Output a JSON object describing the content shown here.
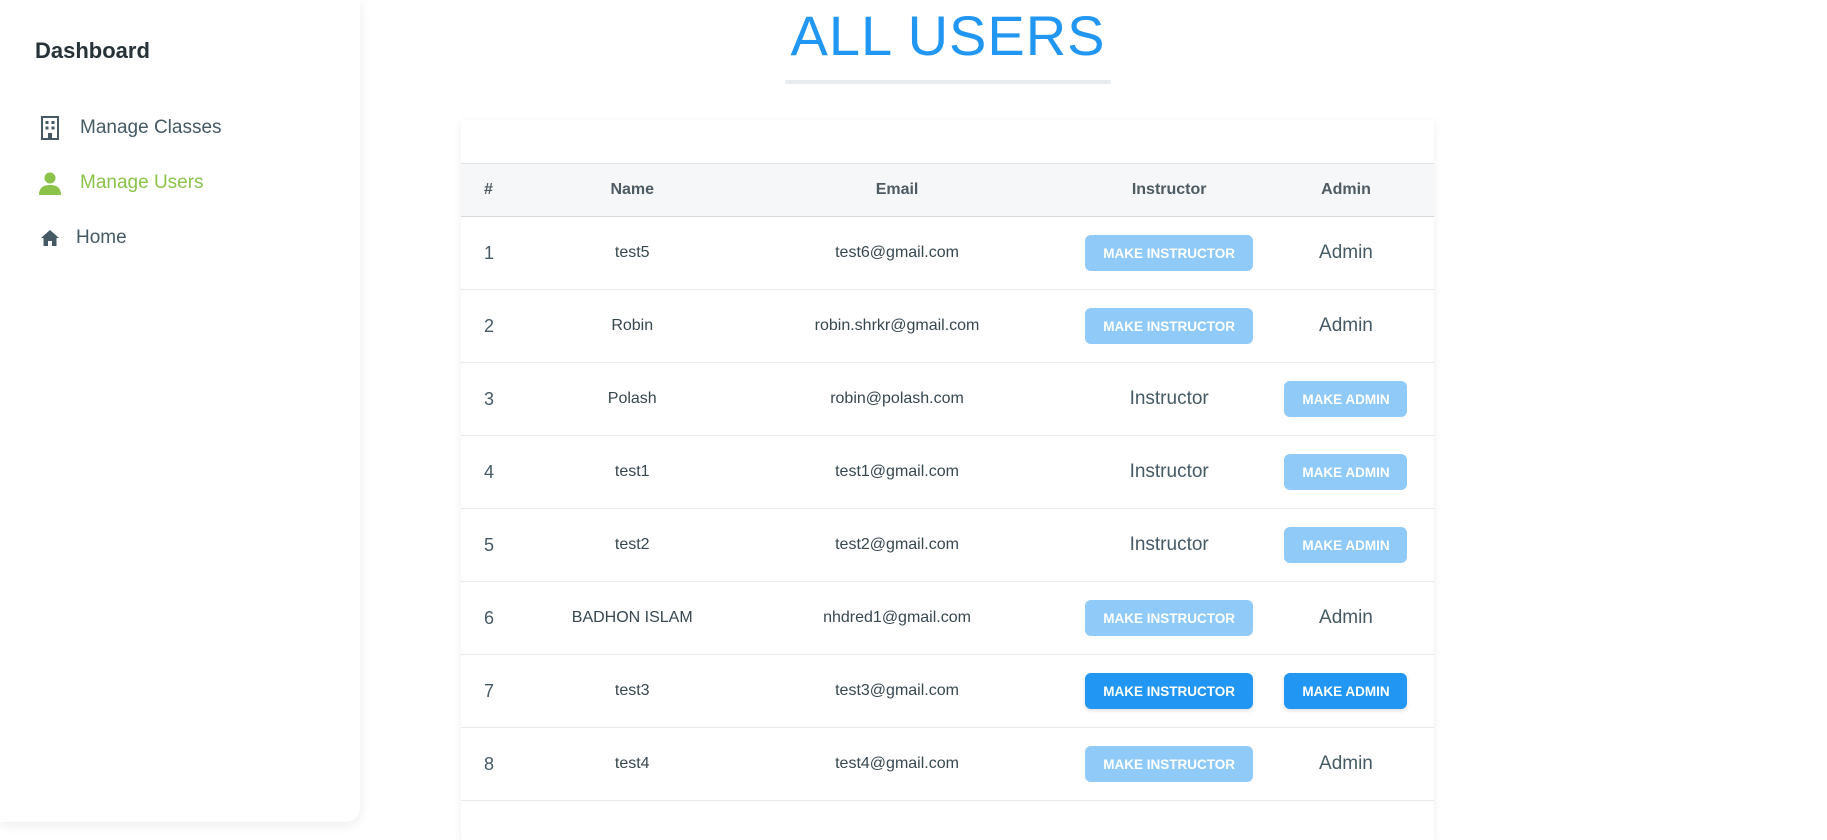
{
  "sidebar": {
    "title": "Dashboard",
    "items": [
      {
        "label": "Manage Classes",
        "icon": "building-icon"
      },
      {
        "label": "Manage Users",
        "icon": "user-icon",
        "active": true
      },
      {
        "label": "Home",
        "icon": "home-icon"
      }
    ]
  },
  "page": {
    "title": "ALL USERS"
  },
  "table": {
    "headers": [
      "#",
      "Name",
      "Email",
      "Instructor",
      "Admin"
    ],
    "rows": [
      {
        "num": "1",
        "name": "test5",
        "email": "test6@gmail.com",
        "instructor": "MAKE INSTRUCTOR",
        "admin": "Admin"
      },
      {
        "num": "2",
        "name": "Robin",
        "email": "robin.shrkr@gmail.com",
        "instructor": "MAKE INSTRUCTOR",
        "admin": "Admin"
      },
      {
        "num": "3",
        "name": "Polash",
        "email": "robin@polash.com",
        "instructor": "Instructor",
        "admin": "MAKE ADMIN"
      },
      {
        "num": "4",
        "name": "test1",
        "email": "test1@gmail.com",
        "instructor": "Instructor",
        "admin": "MAKE ADMIN"
      },
      {
        "num": "5",
        "name": "test2",
        "email": "test2@gmail.com",
        "instructor": "Instructor",
        "admin": "MAKE ADMIN"
      },
      {
        "num": "6",
        "name": "BADHON ISLAM",
        "email": "nhdred1@gmail.com",
        "instructor": "MAKE INSTRUCTOR",
        "admin": "Admin"
      },
      {
        "num": "7",
        "name": "test3",
        "email": "test3@gmail.com",
        "instructor": "MAKE INSTRUCTOR",
        "admin": "MAKE ADMIN"
      },
      {
        "num": "8",
        "name": "test4",
        "email": "test4@gmail.com",
        "instructor": "MAKE INSTRUCTOR",
        "admin": "Admin"
      }
    ]
  },
  "colors": {
    "accent": "#2196f3",
    "button_disabled": "#90caf9",
    "active_nav": "#8bc34a"
  }
}
